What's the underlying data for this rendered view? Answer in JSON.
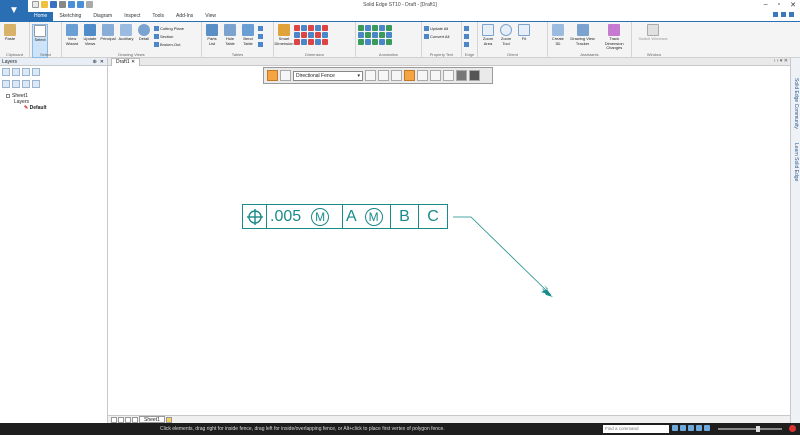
{
  "window": {
    "title": "Solid Edge ST10 - Draft - [Draft1]"
  },
  "tabs": [
    "Home",
    "Sketching",
    "Diagram",
    "Inspect",
    "Tools",
    "Add-Ins",
    "View"
  ],
  "active_tab": "Home",
  "ribbon": {
    "clipboard": {
      "label": "Clipboard",
      "paste": "Paste"
    },
    "select": {
      "label": "Select",
      "select": "Select"
    },
    "drawing_views": {
      "label": "Drawing Views",
      "view_wizard": "View Wizard",
      "update_views": "Update Views",
      "principal": "Principal",
      "auxiliary": "Auxiliary",
      "detail": "Detail",
      "cutting_plane": "Cutting Plane",
      "section": "Section",
      "broken_out": "Broken-Out"
    },
    "tables": {
      "label": "Tables",
      "parts_list": "Parts List",
      "hole_table": "Hole Table",
      "bend_table": "Bend Table"
    },
    "dimension": {
      "label": "Dimension",
      "smart_dimension": "Smart Dimension"
    },
    "annotation": {
      "label": "Annotation"
    },
    "property_text": {
      "label": "Property Text",
      "update_all": "Update All",
      "convert_all": "Convert All"
    },
    "edge": {
      "label": "Edge"
    },
    "orient": {
      "label": "Orient",
      "zoom_area": "Zoom Area",
      "zoom_tool": "Zoom Tool",
      "fit": "Fit"
    },
    "assistants": {
      "label": "Assistants",
      "create_3d": "Create 3D",
      "drawing_view_tracker": "Drawing View Tracker",
      "track_dimension_changes": "Track Dimension Changes"
    },
    "window": {
      "label": "Window",
      "switch_windows": "Switch Windows"
    }
  },
  "panel": {
    "title": "Layers",
    "tree": [
      {
        "level": 1,
        "label": "Sheet1"
      },
      {
        "level": 2,
        "label": "Layers"
      },
      {
        "level": 3,
        "label": "Default"
      }
    ]
  },
  "document_tab": "Draft1",
  "command_bar": {
    "fence_option": "Directional Fence"
  },
  "fcf": {
    "tolerance": ".005",
    "modifier1": "M",
    "datum1": "A",
    "modifier2": "M",
    "datum2": "B",
    "datum3": "C"
  },
  "right_side": {
    "item1": "Solid Edge Community",
    "item2": "Learn Solid Edge"
  },
  "sheet_tab": "Sheet1",
  "status": {
    "message": "Click elements, drag right for inside fence, drag left for inside/overlapping fence, or Alt+click to place first vertex of polygon fence.",
    "command_placeholder": "Find a command"
  },
  "colors": {
    "accent": "#2a6fb3",
    "annotation": "#1a8a8a",
    "status_bg": "#1e1e1e"
  }
}
